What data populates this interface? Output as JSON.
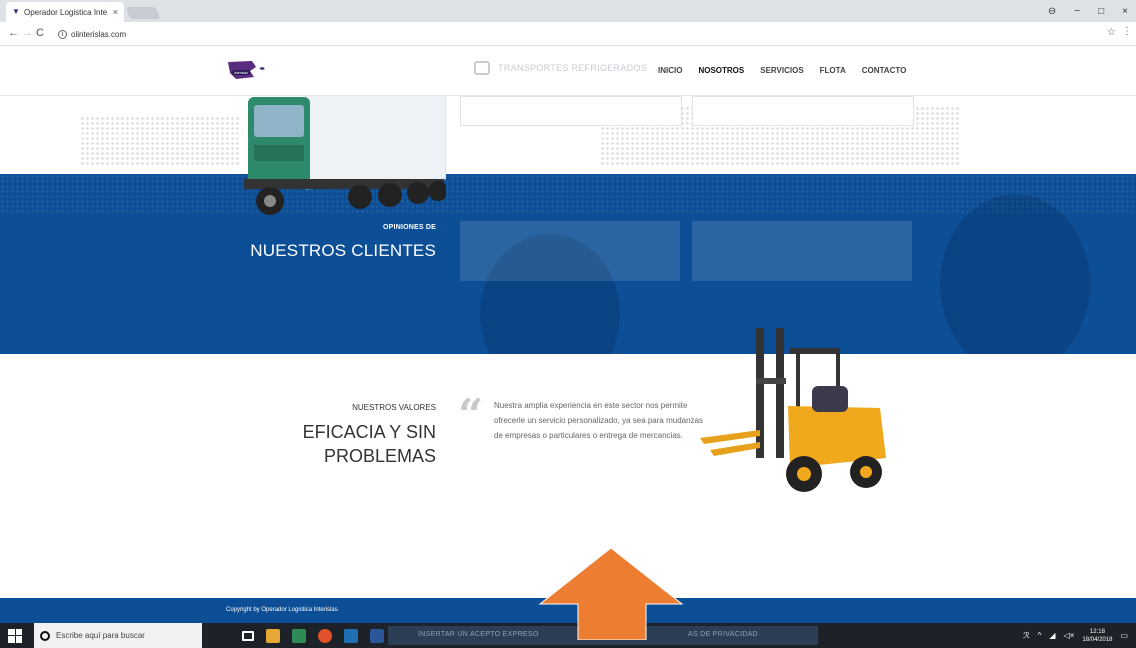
{
  "browser": {
    "tab_title": "Operador Logistica Inte",
    "tab_close": "×",
    "url": "olinterislas.com",
    "window_controls": [
      "−",
      "□",
      "×"
    ],
    "user_icon": "user-circle-icon"
  },
  "site": {
    "ghost_text": "TRANSPORTES REFRIGERADOS",
    "menu": [
      "INICIO",
      "NOSOTROS",
      "SERVICIOS",
      "FLOTA",
      "CONTACTO"
    ],
    "active_menu": "NOSOTROS",
    "testimonials": {
      "small": "OPINIONES DE",
      "big": "NUESTROS CLIENTES"
    },
    "values": {
      "small": "NUESTROS VALORES",
      "big_line1": "EFICACIA Y SIN",
      "big_line2": "PROBLEMAS",
      "quote": "Nuestra amplia experiencia en este sector nos permite ofrecerle un servicio personalizado, ya sea para mudanzas de empresas o particulares o entrega de mercancias."
    },
    "footer": "Copyright by Operador Logistica Interislas",
    "colors": {
      "brand_blue": "#0d4f96",
      "arrow": "#ed7d31"
    }
  },
  "taskbar": {
    "search_placeholder": "Escribe aquí para buscar",
    "running_text": "INSERTAR UN ACEPTO EXPRESO",
    "running_text_right": "AS DE PRIVACIDAD",
    "time": "12:18",
    "date": "18/04/2018"
  }
}
